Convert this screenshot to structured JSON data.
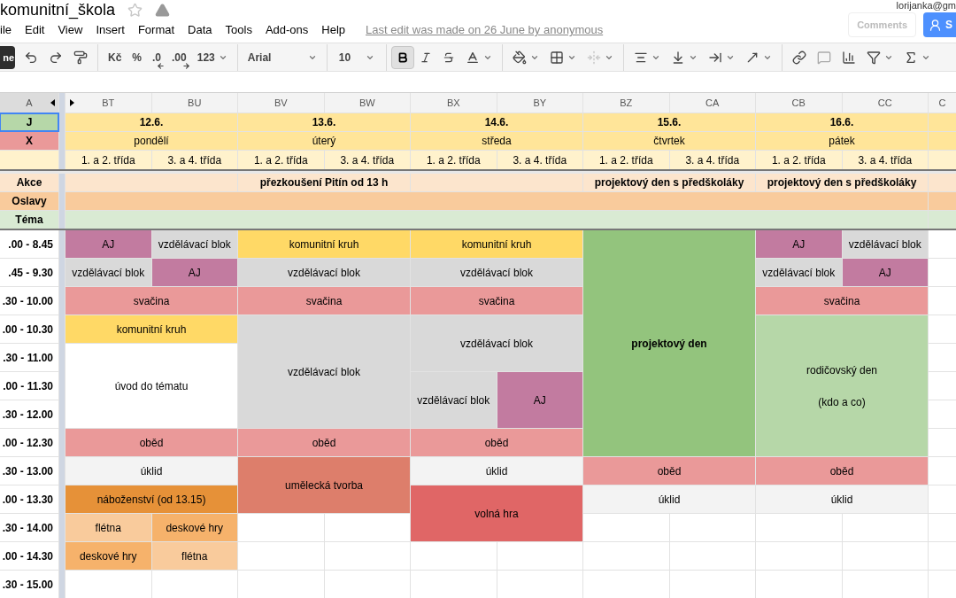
{
  "document": {
    "title": "komunitní_škola",
    "starred": false,
    "account": "lorijanka@gm",
    "last_edit": "Last edit was made on 26 June by anonymous"
  },
  "menu": [
    "ile",
    "Edit",
    "View",
    "Insert",
    "Format",
    "Data",
    "Tools",
    "Add-ons",
    "Help"
  ],
  "buttons": {
    "left": "ne",
    "comments": "Comments",
    "share": "S"
  },
  "toolbar": {
    "currency": "Kč",
    "percent": "%",
    "decrease_decimals": ".0",
    "increase_decimals": ".00",
    "number_format": "123",
    "font": "Arial",
    "size": "10",
    "bold": true,
    "italic": false,
    "strikethrough": false
  },
  "column_headers": [
    "BT",
    "BU",
    "BV",
    "BW",
    "BX",
    "BY",
    "BZ",
    "CA",
    "CB",
    "CC",
    "C"
  ],
  "frozen_column_header": "A",
  "label_rows": [
    {
      "label": "J",
      "color": "#b6d7a8",
      "selected": true
    },
    {
      "label": "X",
      "color": "#ea9999",
      "selected": false
    }
  ],
  "info_rows": [
    {
      "label": "Akce",
      "color": "#fce5cd"
    },
    {
      "label": "Oslavy",
      "color": "#f9cb9c"
    },
    {
      "label": "Téma",
      "color": "#d9ead3"
    }
  ],
  "days": [
    {
      "date": "12.6.",
      "name": "pondělí",
      "classes": [
        "1. a 2. třída",
        "3. a 4. třída"
      ]
    },
    {
      "date": "13.6.",
      "name": "úterý",
      "classes": [
        "1. a 2. třída",
        "3. a 4. třída"
      ],
      "event": "přezkoušení Pitín od 13 h"
    },
    {
      "date": "14.6.",
      "name": "středa",
      "classes": [
        "1. a 2. třída",
        "3. a 4. třída"
      ]
    },
    {
      "date": "15.6.",
      "name": "čtvrtek",
      "classes": [
        "1. a 2. třída",
        "3. a 4. třída"
      ],
      "event": "projektový den s předškoláky"
    },
    {
      "date": "16.6.",
      "name": "pátek",
      "classes": [
        "1. a 2. třída",
        "3. a 4. třída"
      ],
      "event": "projektový den s předškoláky"
    }
  ],
  "schedule": [
    {
      "time": ".00 - 8.45",
      "cells": [
        {
          "kind": "cell",
          "text": "AJ",
          "color": "#c27ba0"
        },
        {
          "kind": "cell",
          "text": "vzdělávací blok",
          "color": "#d9d9d9"
        },
        {
          "kind": "cell",
          "text": "komunitní kruh",
          "color": "#ffd966"
        },
        {
          "kind": "left"
        },
        {
          "kind": "cell",
          "text": "komunitní kruh",
          "color": "#ffd966"
        },
        {
          "kind": "left"
        },
        {
          "kind": "cell",
          "text": "projektový den",
          "color": "#93c47d",
          "bold": true
        },
        {
          "kind": "left"
        },
        {
          "kind": "cell",
          "text": "AJ",
          "color": "#c27ba0"
        },
        {
          "kind": "cell",
          "text": "vzdělávací blok",
          "color": "#d9d9d9"
        }
      ]
    },
    {
      "time": ".45 - 9.30",
      "cells": [
        {
          "kind": "cell",
          "text": "vzdělávací blok",
          "color": "#d9d9d9"
        },
        {
          "kind": "cell",
          "text": "AJ",
          "color": "#c27ba0"
        },
        {
          "kind": "cell",
          "text": "vzdělávací blok",
          "color": "#d9d9d9"
        },
        {
          "kind": "left"
        },
        {
          "kind": "cell",
          "text": "vzdělávací blok",
          "color": "#d9d9d9"
        },
        {
          "kind": "left"
        },
        {
          "kind": "up"
        },
        {
          "kind": "up"
        },
        {
          "kind": "cell",
          "text": "vzdělávací blok",
          "color": "#d9d9d9"
        },
        {
          "kind": "cell",
          "text": "AJ",
          "color": "#c27ba0"
        }
      ]
    },
    {
      "time": ".30 - 10.00",
      "cells": [
        {
          "kind": "cell",
          "text": "svačina",
          "color": "#ea9999"
        },
        {
          "kind": "left"
        },
        {
          "kind": "cell",
          "text": "svačina",
          "color": "#ea9999"
        },
        {
          "kind": "left"
        },
        {
          "kind": "cell",
          "text": "svačina",
          "color": "#ea9999"
        },
        {
          "kind": "left"
        },
        {
          "kind": "up"
        },
        {
          "kind": "up"
        },
        {
          "kind": "cell",
          "text": "svačina",
          "color": "#ea9999"
        },
        {
          "kind": "left"
        }
      ]
    },
    {
      "time": ".00 - 10.30",
      "cells": [
        {
          "kind": "cell",
          "text": "komunitní kruh",
          "color": "#ffd966"
        },
        {
          "kind": "left"
        },
        {
          "kind": "cell",
          "text": "vzdělávací blok",
          "color": "#d9d9d9"
        },
        {
          "kind": "left"
        },
        {
          "kind": "cell",
          "text": "vzdělávací blok",
          "color": "#d9d9d9"
        },
        {
          "kind": "left"
        },
        {
          "kind": "up"
        },
        {
          "kind": "up"
        },
        {
          "kind": "cell",
          "text": "rodičovský den",
          "note": "(kdo a co)",
          "color": "#b6d7a8"
        },
        {
          "kind": "left"
        }
      ]
    },
    {
      "time": ".30 - 11.00",
      "cells": [
        {
          "kind": "cell",
          "text": "úvod do tématu",
          "color": "#ffffff"
        },
        {
          "kind": "left"
        },
        {
          "kind": "up"
        },
        {
          "kind": "up"
        },
        {
          "kind": "up"
        },
        {
          "kind": "up"
        },
        {
          "kind": "up"
        },
        {
          "kind": "up"
        },
        {
          "kind": "up"
        },
        {
          "kind": "up"
        }
      ]
    },
    {
      "time": ".00 - 11.30",
      "cells": [
        {
          "kind": "up"
        },
        {
          "kind": "up"
        },
        {
          "kind": "up"
        },
        {
          "kind": "up"
        },
        {
          "kind": "cell",
          "text": "vzdělávací blok",
          "color": "#d9d9d9"
        },
        {
          "kind": "cell",
          "text": "AJ",
          "color": "#c27ba0"
        },
        {
          "kind": "up"
        },
        {
          "kind": "up"
        },
        {
          "kind": "up"
        },
        {
          "kind": "up"
        }
      ]
    },
    {
      "time": ".30 - 12.00",
      "cells": [
        {
          "kind": "up"
        },
        {
          "kind": "up"
        },
        {
          "kind": "up"
        },
        {
          "kind": "up"
        },
        {
          "kind": "up"
        },
        {
          "kind": "up"
        },
        {
          "kind": "up"
        },
        {
          "kind": "up"
        },
        {
          "kind": "up"
        },
        {
          "kind": "up"
        }
      ]
    },
    {
      "time": ".00 - 12.30",
      "cells": [
        {
          "kind": "cell",
          "text": "oběd",
          "color": "#ea9999"
        },
        {
          "kind": "left"
        },
        {
          "kind": "cell",
          "text": "oběd",
          "color": "#ea9999"
        },
        {
          "kind": "left"
        },
        {
          "kind": "cell",
          "text": "oběd",
          "color": "#ea9999"
        },
        {
          "kind": "left"
        },
        {
          "kind": "up"
        },
        {
          "kind": "up"
        },
        {
          "kind": "up"
        },
        {
          "kind": "up"
        }
      ]
    },
    {
      "time": ".30 - 13.00",
      "cells": [
        {
          "kind": "cell",
          "text": "úklid",
          "color": "#f3f3f3"
        },
        {
          "kind": "left"
        },
        {
          "kind": "cell",
          "text": "umělecká tvorba",
          "color": "#dd7e6b"
        },
        {
          "kind": "left"
        },
        {
          "kind": "cell",
          "text": "úklid",
          "color": "#f3f3f3"
        },
        {
          "kind": "left"
        },
        {
          "kind": "cell",
          "text": "oběd",
          "color": "#ea9999"
        },
        {
          "kind": "left"
        },
        {
          "kind": "cell",
          "text": "oběd",
          "color": "#ea9999"
        },
        {
          "kind": "left"
        }
      ]
    },
    {
      "time": ".00 - 13.30",
      "cells": [
        {
          "kind": "cell",
          "text": "náboženství (od 13.15)",
          "color": "#e69138"
        },
        {
          "kind": "left"
        },
        {
          "kind": "up"
        },
        {
          "kind": "up"
        },
        {
          "kind": "cell",
          "text": "volná hra",
          "color": "#e06666"
        },
        {
          "kind": "left"
        },
        {
          "kind": "cell",
          "text": "úklid",
          "color": "#f3f3f3"
        },
        {
          "kind": "left"
        },
        {
          "kind": "cell",
          "text": "úklid",
          "color": "#f3f3f3"
        },
        {
          "kind": "left"
        }
      ]
    },
    {
      "time": ".30 - 14.00",
      "cells": [
        {
          "kind": "cell",
          "text": "flétna",
          "color": "#f9cb9c"
        },
        {
          "kind": "cell",
          "text": "deskové hry",
          "color": "#f6b26b"
        },
        {
          "kind": "empty"
        },
        {
          "kind": "empty"
        },
        {
          "kind": "up"
        },
        {
          "kind": "up"
        },
        {
          "kind": "empty"
        },
        {
          "kind": "empty"
        },
        {
          "kind": "empty"
        },
        {
          "kind": "empty"
        }
      ]
    },
    {
      "time": ".00 - 14.30",
      "cells": [
        {
          "kind": "cell",
          "text": "deskové hry",
          "color": "#f6b26b"
        },
        {
          "kind": "cell",
          "text": "flétna",
          "color": "#f9cb9c"
        },
        {
          "kind": "empty"
        },
        {
          "kind": "empty"
        },
        {
          "kind": "empty"
        },
        {
          "kind": "empty"
        },
        {
          "kind": "empty"
        },
        {
          "kind": "empty"
        },
        {
          "kind": "empty"
        },
        {
          "kind": "empty"
        }
      ]
    },
    {
      "time": ".30 - 15.00",
      "cells": [
        {
          "kind": "empty"
        },
        {
          "kind": "empty"
        },
        {
          "kind": "empty"
        },
        {
          "kind": "empty"
        },
        {
          "kind": "empty"
        },
        {
          "kind": "empty"
        },
        {
          "kind": "empty"
        },
        {
          "kind": "empty"
        },
        {
          "kind": "empty"
        },
        {
          "kind": "empty"
        }
      ]
    }
  ]
}
